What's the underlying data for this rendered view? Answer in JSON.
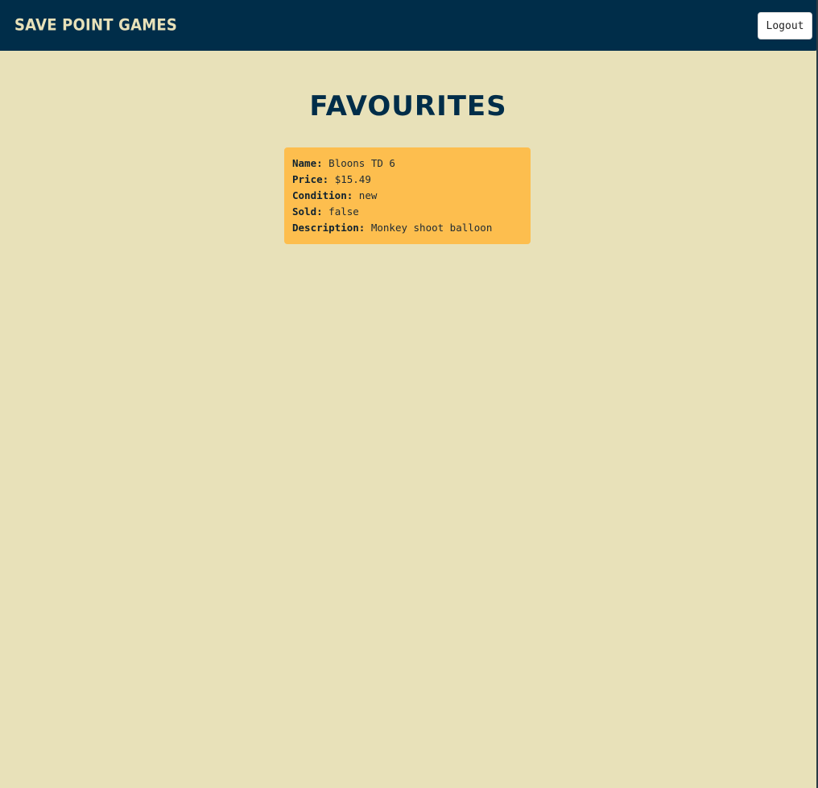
{
  "header": {
    "brand": "Save Point Games",
    "logout_label": "Logout"
  },
  "main": {
    "title": "Favourites",
    "favourites": [
      {
        "name_label": "Name:",
        "name": "Bloons TD 6",
        "price_label": "Price:",
        "price": "$15.49",
        "condition_label": "Condition:",
        "condition": "new",
        "sold_label": "Sold:",
        "sold": "false",
        "description_label": "Description:",
        "description": "Monkey shoot balloon"
      }
    ]
  },
  "colors": {
    "navbar": "#002d49",
    "background": "#e8e1b9",
    "card": "#fdbe4e",
    "brand_text": "#e8e1b9"
  }
}
